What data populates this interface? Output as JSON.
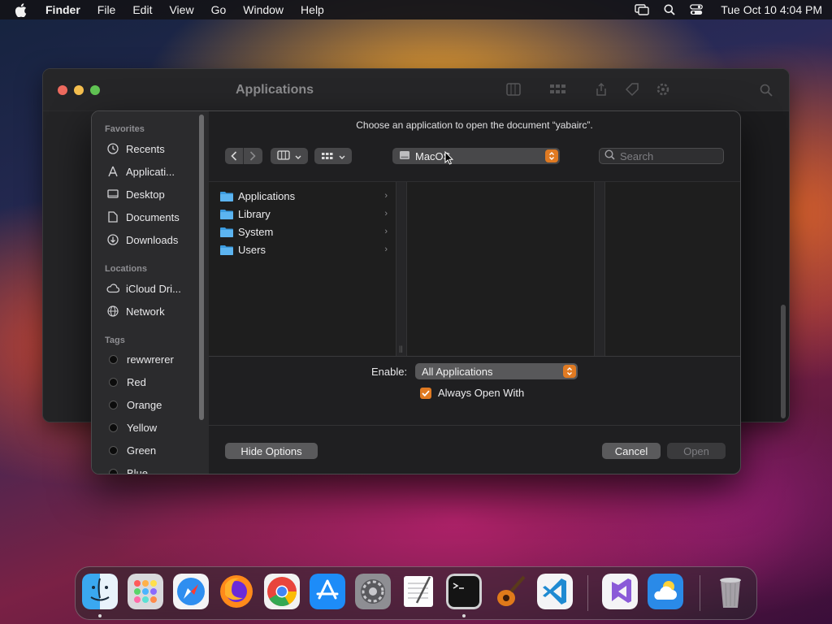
{
  "menubar": {
    "app_name": "Finder",
    "items": [
      "File",
      "Edit",
      "View",
      "Go",
      "Window",
      "Help"
    ],
    "clock": "Tue Oct 10  4:04 PM"
  },
  "finder_window": {
    "title": "Applications"
  },
  "dialog": {
    "prompt": "Choose an application to open the document “yabairc”.",
    "location": "MacOS",
    "search_placeholder": "Search",
    "sidebar": {
      "favorites_header": "Favorites",
      "favorites": [
        "Recents",
        "Applicati...",
        "Desktop",
        "Documents",
        "Downloads"
      ],
      "locations_header": "Locations",
      "locations": [
        "iCloud Dri...",
        "Network"
      ],
      "tags_header": "Tags",
      "tags": [
        "rewwrerer",
        "Red",
        "Orange",
        "Yellow",
        "Green",
        "Blue"
      ]
    },
    "browser_items": [
      "Applications",
      "Library",
      "System",
      "Users"
    ],
    "enable_label": "Enable:",
    "enable_value": "All Applications",
    "always_open_with": "Always Open With",
    "always_open_checked": true,
    "hide_options": "Hide Options",
    "cancel": "Cancel",
    "open": "Open"
  },
  "colors": {
    "accent": "#e07a22",
    "folder": "#3c9ce0"
  },
  "dock": {
    "icons": [
      "finder-icon",
      "launchpad-icon",
      "safari-icon",
      "firefox-icon",
      "chrome-icon",
      "app-store-icon",
      "system-settings-icon",
      "textedit-icon",
      "terminal-icon",
      "garageband-icon",
      "vscode-icon",
      "visual-studio-icon",
      "weather-icon",
      "trash-icon"
    ]
  }
}
